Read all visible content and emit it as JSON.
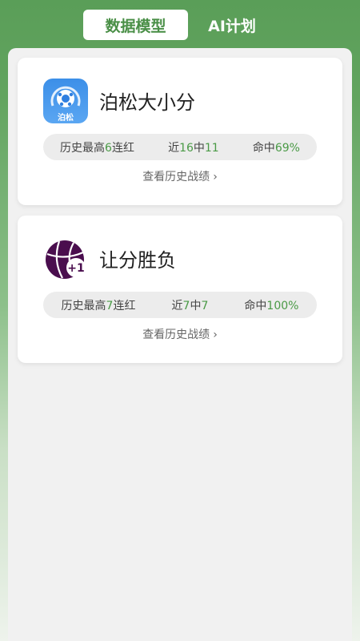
{
  "tabs": [
    {
      "label": "数据模型",
      "active": true
    },
    {
      "label": "AI计划",
      "active": false
    }
  ],
  "colors": {
    "accent": "#4a9a46",
    "header_green": "#5a9e58"
  },
  "cards": [
    {
      "title": "泊松大小分",
      "logo_icon": "poisson-soccer-icon",
      "logo_text": "泊松",
      "stats": {
        "streak_prefix": "历史最高",
        "streak_value": "6",
        "streak_suffix": "连红",
        "recent_prefix": "近",
        "recent_total": "16",
        "recent_mid": "中",
        "recent_hit": "11",
        "rate_prefix": "命中",
        "rate_value": "69%"
      },
      "history_label": "查看历史战绩"
    },
    {
      "title": "让分胜负",
      "logo_icon": "basketball-plus-one-icon",
      "logo_text": "+1",
      "stats": {
        "streak_prefix": "历史最高",
        "streak_value": "7",
        "streak_suffix": "连红",
        "recent_prefix": "近",
        "recent_total": "7",
        "recent_mid": "中",
        "recent_hit": "7",
        "rate_prefix": "命中",
        "rate_value": "100%"
      },
      "history_label": "查看历史战绩"
    }
  ]
}
